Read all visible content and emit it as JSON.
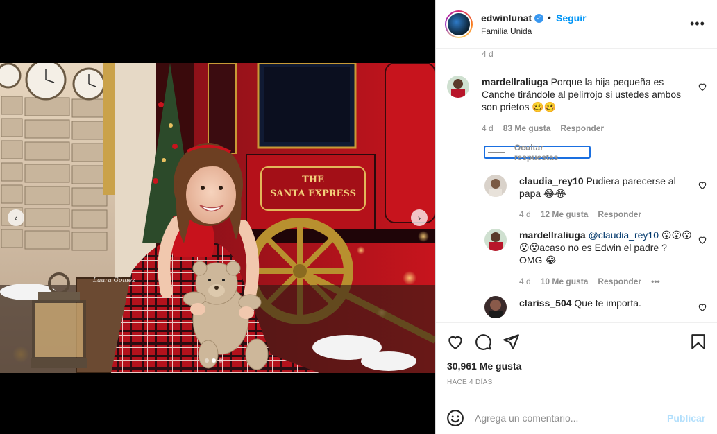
{
  "header": {
    "username": "edwinlunat",
    "verified_glyph": "✓",
    "separator": "•",
    "follow_label": "Seguir",
    "location": "Familia Unida",
    "more_icon": "more-horizontal-icon"
  },
  "media": {
    "watermark": "Laura Gómez",
    "sign_line1": "THE",
    "sign_line2": "SANTA EXPRESS",
    "prev_glyph": "‹",
    "next_glyph": "›",
    "slide_count": 3,
    "active_slide": 2
  },
  "comments": {
    "top_age": "4 d",
    "items": [
      {
        "username": "mardellraliuga",
        "text": "Porque la hija pequeña es Canche tirándole al pelirrojo si ustedes ambos son prietos 🥴🥴",
        "age": "4 d",
        "likes": "83 Me gusta",
        "reply": "Responder"
      }
    ],
    "hide_replies_label": "Ocultar respuestas",
    "replies": [
      {
        "username": "claudia_rey10",
        "text": "Pudiera parecerse al papa 😂😂",
        "age": "4 d",
        "likes": "12 Me gusta",
        "reply": "Responder"
      },
      {
        "username": "mardellraliuga",
        "mention": "@claudia_rey10",
        "text": "😮😮😮😮😮acaso no es Edwin el padre ? OMG 😂",
        "age": "4 d",
        "likes": "10 Me gusta",
        "reply": "Responder",
        "more": "•••"
      },
      {
        "username": "clariss_504",
        "text": "Que te importa."
      }
    ]
  },
  "actions": {
    "likes": "30,961 Me gusta",
    "date": "HACE 4 DÍAS"
  },
  "add_comment": {
    "placeholder": "Agrega un comentario...",
    "publish_label": "Publicar"
  },
  "colors": {
    "accent": "#0095f6",
    "publish_disabled": "#b2dffc",
    "text": "#262626",
    "muted": "#8e8e8e"
  }
}
